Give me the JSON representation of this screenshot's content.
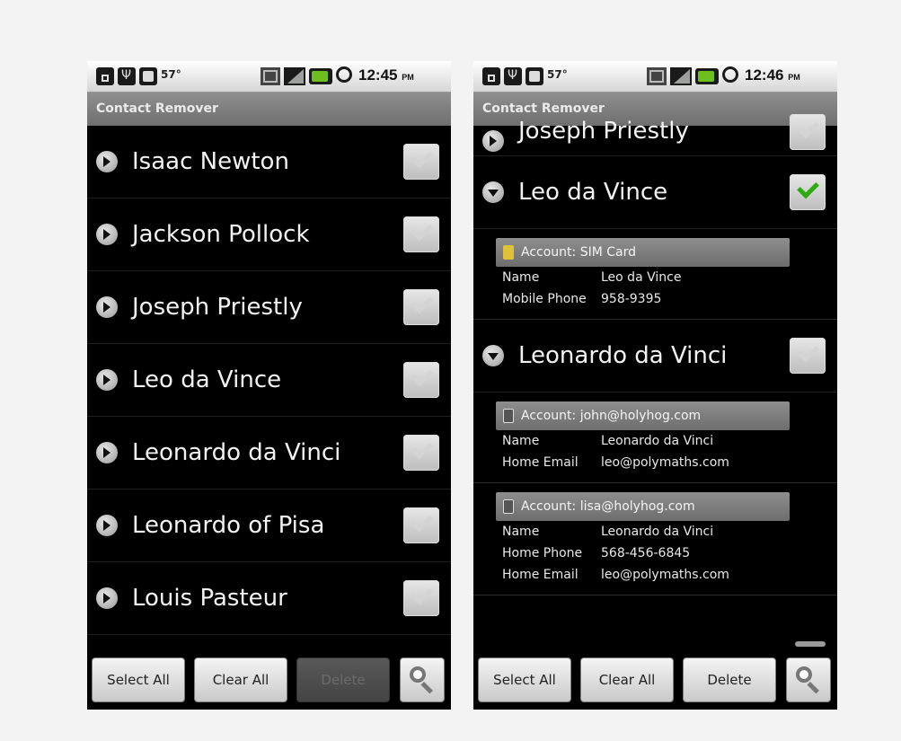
{
  "status_left": {
    "temperature": "57°",
    "time": "12:45",
    "ampm": "PM"
  },
  "status_right": {
    "temperature": "57°",
    "time": "12:46",
    "ampm": "PM"
  },
  "app_title": "Contact Remover",
  "left_list": [
    {
      "name": "Isaac Newton",
      "checked": false
    },
    {
      "name": "Jackson Pollock",
      "checked": false
    },
    {
      "name": "Joseph Priestly",
      "checked": false
    },
    {
      "name": "Leo da Vince",
      "checked": false
    },
    {
      "name": "Leonardo da Vinci",
      "checked": false
    },
    {
      "name": "Leonardo of Pisa",
      "checked": false
    },
    {
      "name": "Louis Pasteur",
      "checked": false
    }
  ],
  "right_view": {
    "partial_row": {
      "name": "Joseph Priestly",
      "checked": false
    },
    "contact1": {
      "name": "Leo da Vince",
      "checked": true,
      "accounts": [
        {
          "label": "Account: SIM Card",
          "icon": "sim-card-icon",
          "fields": [
            {
              "label": "Name",
              "value": "Leo da Vince"
            },
            {
              "label": "Mobile Phone",
              "value": "958-9395"
            }
          ]
        }
      ]
    },
    "contact2": {
      "name": "Leonardo da Vinci",
      "checked": false,
      "accounts": [
        {
          "label": "Account: john@holyhog.com",
          "icon": "sync-account-icon",
          "fields": [
            {
              "label": "Name",
              "value": "Leonardo da Vinci"
            },
            {
              "label": "Home Email",
              "value": "leo@polymaths.com"
            }
          ]
        },
        {
          "label": "Account: lisa@holyhog.com",
          "icon": "sync-account-icon",
          "fields": [
            {
              "label": "Name",
              "value": "Leonardo da Vinci"
            },
            {
              "label": "Home Phone",
              "value": "568-456-6845"
            },
            {
              "label": "Home Email",
              "value": "leo@polymaths.com"
            }
          ]
        }
      ]
    }
  },
  "buttons": {
    "select_all": "Select All",
    "clear_all": "Clear All",
    "delete": "Delete",
    "search_icon": "search-icon"
  },
  "colors": {
    "check_green": "#2eaa11",
    "title_bar": "#7f7f7f"
  }
}
